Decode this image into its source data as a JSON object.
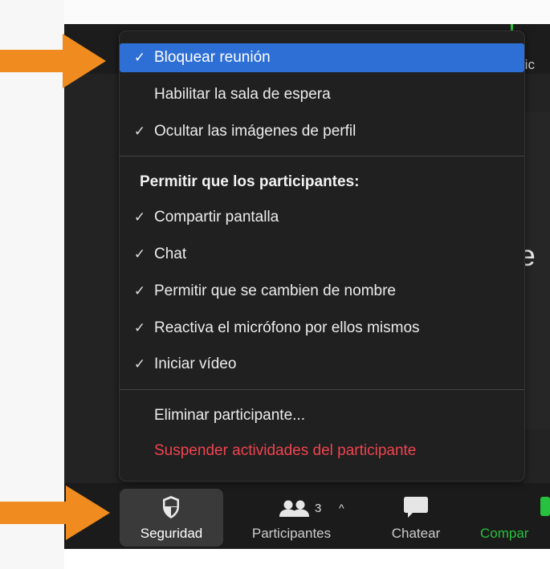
{
  "colors": {
    "accent": "#2e6fd6",
    "danger": "#f0434f",
    "arrow": "#f08c1f",
    "share_green": "#27c13f"
  },
  "background_text": {
    "top_right_peek": "ric",
    "middle_right_peek": "te"
  },
  "menu": {
    "items": [
      {
        "label": "Bloquear reunión",
        "checked": true,
        "selected": true
      },
      {
        "label": "Habilitar la sala de espera",
        "checked": false
      },
      {
        "label": "Ocultar las imágenes de perfil",
        "checked": true
      }
    ],
    "section_header": "Permitir que los participantes:",
    "participant_items": [
      {
        "label": "Compartir pantalla",
        "checked": true
      },
      {
        "label": "Chat",
        "checked": true
      },
      {
        "label": "Permitir que se cambien de nombre",
        "checked": true
      },
      {
        "label": "Reactiva el micrófono por ellos mismos",
        "checked": true
      },
      {
        "label": "Iniciar vídeo",
        "checked": true
      }
    ],
    "actions": [
      {
        "label": "Eliminar participante..."
      },
      {
        "label": "Suspender actividades del participante",
        "danger": true
      }
    ],
    "check_glyph": "✓"
  },
  "toolbar": {
    "security": {
      "label": "Seguridad",
      "icon": "shield-icon"
    },
    "participants": {
      "label": "Participantes",
      "icon": "participants-icon",
      "count": "3",
      "caret": "^"
    },
    "chat": {
      "label": "Chatear",
      "icon": "chat-bubble-icon"
    },
    "share": {
      "label": "Compar",
      "icon": "share-screen-icon"
    }
  },
  "annotations": [
    {
      "icon": "arrow-right-icon",
      "target": "lock-meeting"
    },
    {
      "icon": "arrow-right-icon",
      "target": "security-button"
    }
  ]
}
